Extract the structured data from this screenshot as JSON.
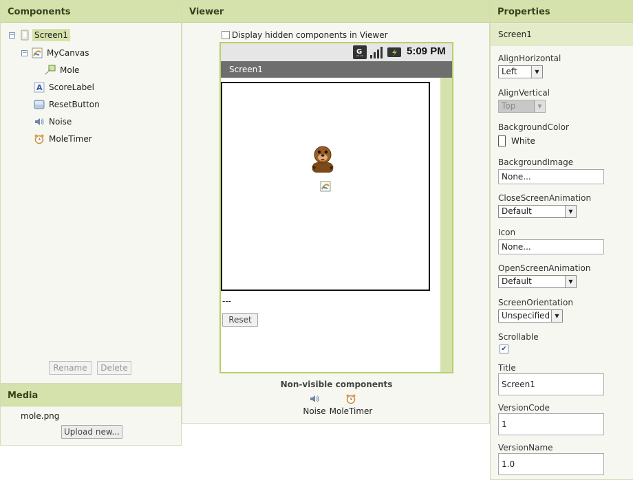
{
  "components": {
    "header": "Components",
    "tree": [
      {
        "label": "Screen1",
        "icon": "screen-icon"
      },
      {
        "label": "MyCanvas",
        "icon": "canvas-icon"
      },
      {
        "label": "Mole",
        "icon": "sprite-icon"
      },
      {
        "label": "ScoreLabel",
        "icon": "label-icon"
      },
      {
        "label": "ResetButton",
        "icon": "button-icon"
      },
      {
        "label": "Noise",
        "icon": "speaker-icon"
      },
      {
        "label": "MoleTimer",
        "icon": "clock-icon"
      }
    ],
    "rename_label": "Rename",
    "delete_label": "Delete"
  },
  "media": {
    "header": "Media",
    "files": [
      "mole.png"
    ],
    "upload_label": "Upload new..."
  },
  "viewer": {
    "header": "Viewer",
    "hidden_checkbox_label": "Display hidden components in Viewer",
    "status_time": "5:09 PM",
    "screen_title": "Screen1",
    "score_label_text": "---",
    "reset_button_label": "Reset",
    "nonvisible_header": "Non-visible components",
    "nonvisible": [
      {
        "label": "Noise",
        "icon": "speaker-icon"
      },
      {
        "label": "MoleTimer",
        "icon": "clock-icon"
      }
    ]
  },
  "properties": {
    "header": "Properties",
    "component": "Screen1",
    "align_horizontal_label": "AlignHorizontal",
    "align_horizontal_value": "Left",
    "align_vertical_label": "AlignVertical",
    "align_vertical_value": "Top",
    "background_color_label": "BackgroundColor",
    "background_color_value": "White",
    "background_image_label": "BackgroundImage",
    "background_image_value": "None...",
    "close_anim_label": "CloseScreenAnimation",
    "close_anim_value": "Default",
    "icon_label": "Icon",
    "icon_value": "None...",
    "open_anim_label": "OpenScreenAnimation",
    "open_anim_value": "Default",
    "orientation_label": "ScreenOrientation",
    "orientation_value": "Unspecified",
    "scrollable_label": "Scrollable",
    "scrollable_checked": true,
    "title_label": "Title",
    "title_value": "Screen1",
    "version_code_label": "VersionCode",
    "version_code_value": "1",
    "version_name_label": "VersionName",
    "version_name_value": "1.0"
  },
  "colors": {
    "header_bg": "#d6e2ab",
    "accent_green": "#b5d06a",
    "selected_bg": "#d6e2ab"
  }
}
